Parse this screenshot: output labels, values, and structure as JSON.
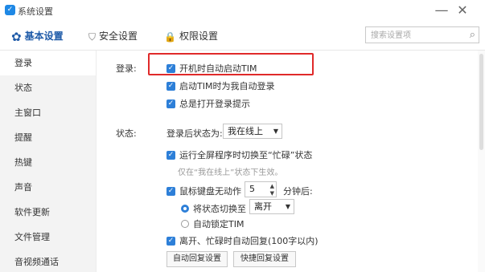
{
  "window": {
    "title": "系统设置",
    "minimize": "—",
    "close": "✕"
  },
  "tabs": [
    {
      "label": "基本设置",
      "icon": "gear-icon",
      "glyph": "✿"
    },
    {
      "label": "安全设置",
      "icon": "shield-icon",
      "glyph": "⛉"
    },
    {
      "label": "权限设置",
      "icon": "lock-icon",
      "glyph": "🔒"
    }
  ],
  "search": {
    "placeholder": "搜索设置项",
    "icon": "search-icon",
    "glyph": "⌕"
  },
  "sidebar": {
    "items": [
      {
        "label": "登录"
      },
      {
        "label": "状态"
      },
      {
        "label": "主窗口"
      },
      {
        "label": "提醒"
      },
      {
        "label": "热键"
      },
      {
        "label": "声音"
      },
      {
        "label": "软件更新"
      },
      {
        "label": "文件管理"
      },
      {
        "label": "音视频通话"
      }
    ],
    "active_index": 0
  },
  "login": {
    "section_label": "登录:",
    "options": [
      {
        "label": "开机时自动启动TIM",
        "checked": true
      },
      {
        "label": "启动TIM时为我自动登录",
        "checked": true
      },
      {
        "label": "总是打开登录提示",
        "checked": true
      }
    ]
  },
  "status": {
    "section_label": "状态:",
    "after_login_label": "登录后状态为:",
    "after_login_value": "我在线上",
    "fullscreen_option": {
      "label": "运行全屏程序时切换至“忙碌”状态",
      "checked": true
    },
    "fullscreen_hint": "仅在“我在线上”状态下生效。",
    "idle_option": {
      "label": "鼠标键盘无动作",
      "checked": true
    },
    "idle_minutes": "5",
    "idle_suffix": "分钟后:",
    "switch_radio": {
      "label": "将状态切换至",
      "selected": true
    },
    "switch_value": "离开",
    "lock_radio": {
      "label": "自动锁定TIM",
      "selected": false
    },
    "auto_reply_option": {
      "label": "离开、忙碌时自动回复(100字以内)",
      "checked": true
    },
    "buttons": {
      "auto_reply": "自动回复设置",
      "quick_reply": "快捷回复设置"
    }
  },
  "colors": {
    "accent": "#2d7fd8",
    "highlight_border": "#e02a2a",
    "sidebar_bg": "#f3f3f3"
  }
}
